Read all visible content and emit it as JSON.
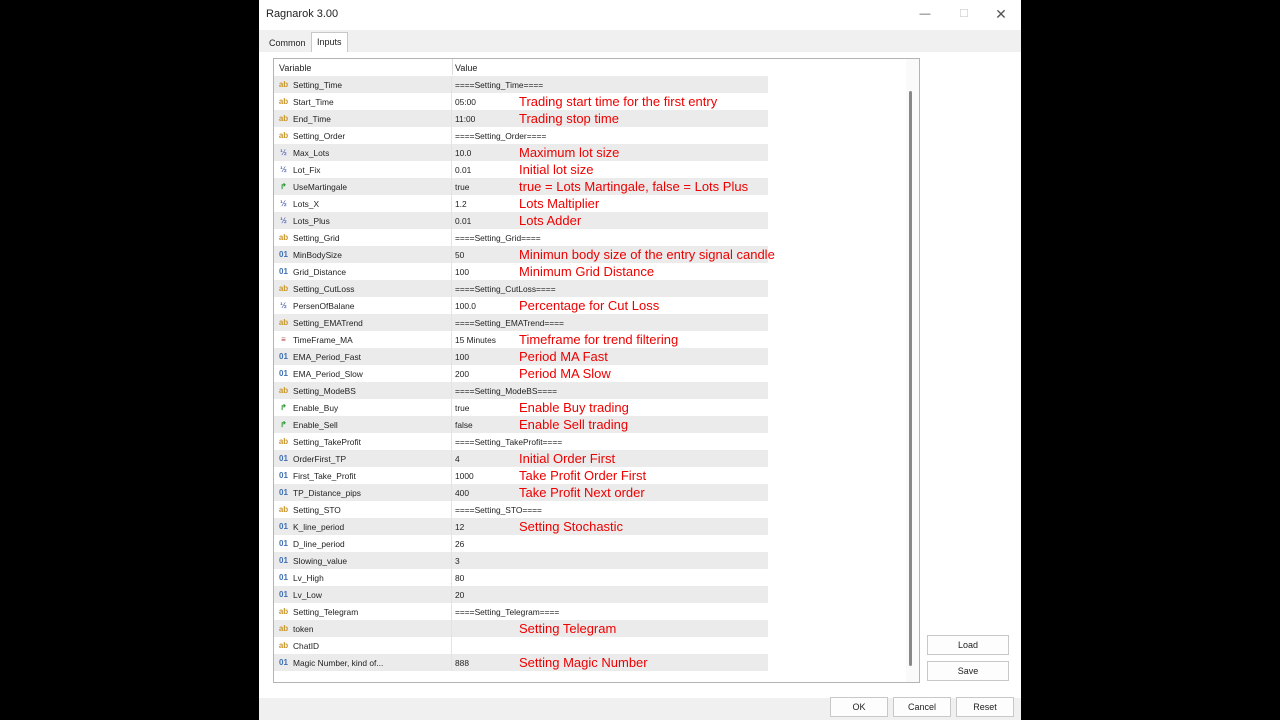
{
  "window": {
    "title": "Ragnarok  3.00",
    "minimize": "—",
    "maximize": "☐",
    "close": "✕"
  },
  "tabs": [
    {
      "label": "Common"
    },
    {
      "label": "Inputs"
    }
  ],
  "table": {
    "headers": {
      "variable": "Variable",
      "value": "Value"
    },
    "rows": [
      {
        "type": "ab",
        "icon": "ab",
        "name": "Setting_Time",
        "value": "====Setting_Time====",
        "note": ""
      },
      {
        "type": "ab",
        "icon": "ab",
        "name": "Start_Time",
        "value": "05:00",
        "note": "Trading start time for the  first entry"
      },
      {
        "type": "ab",
        "icon": "ab",
        "name": "End_Time",
        "value": "11:00",
        "note": "Trading stop time"
      },
      {
        "type": "ab",
        "icon": "ab",
        "name": "Setting_Order",
        "value": "====Setting_Order====",
        "note": ""
      },
      {
        "type": "half",
        "icon": "½",
        "name": "Max_Lots",
        "value": "10.0",
        "note": "Maximum  lot size"
      },
      {
        "type": "half",
        "icon": "½",
        "name": "Lot_Fix",
        "value": "0.01",
        "note": "Initial lot size"
      },
      {
        "type": "bool",
        "icon": "↱",
        "name": "UseMartingale",
        "value": "true",
        "note": "true = Lots Martingale, false = Lots Plus"
      },
      {
        "type": "half",
        "icon": "½",
        "name": "Lots_X",
        "value": "1.2",
        "note": "Lots Maltiplier"
      },
      {
        "type": "half",
        "icon": "½",
        "name": "Lots_Plus",
        "value": "0.01",
        "note": "Lots Adder"
      },
      {
        "type": "ab",
        "icon": "ab",
        "name": "Setting_Grid",
        "value": "====Setting_Grid====",
        "note": ""
      },
      {
        "type": "01",
        "icon": "01",
        "name": "MinBodySize",
        "value": "50",
        "note": "Minimun  body size of the entry signal candle"
      },
      {
        "type": "01",
        "icon": "01",
        "name": "Grid_Distance",
        "value": "100",
        "note": "Minimum  Grid Distance"
      },
      {
        "type": "ab",
        "icon": "ab",
        "name": "Setting_CutLoss",
        "value": "====Setting_CutLoss====",
        "note": ""
      },
      {
        "type": "half",
        "icon": "½",
        "name": "PersenOfBalane",
        "value": "100.0",
        "note": "Percentage for Cut Loss"
      },
      {
        "type": "ab",
        "icon": "ab",
        "name": "Setting_EMATrend",
        "value": "====Setting_EMATrend====",
        "note": ""
      },
      {
        "type": "enum",
        "icon": "≡",
        "name": "TimeFrame_MA",
        "value": "15 Minutes",
        "note": "Timeframe for trend filtering"
      },
      {
        "type": "01",
        "icon": "01",
        "name": "EMA_Period_Fast",
        "value": "100",
        "note": "Period MA Fast"
      },
      {
        "type": "01",
        "icon": "01",
        "name": "EMA_Period_Slow",
        "value": "200",
        "note": "Period MA Slow"
      },
      {
        "type": "ab",
        "icon": "ab",
        "name": "Setting_ModeBS",
        "value": "====Setting_ModeBS====",
        "note": ""
      },
      {
        "type": "bool",
        "icon": "↱",
        "name": "Enable_Buy",
        "value": "true",
        "note": "Enable Buy trading"
      },
      {
        "type": "bool",
        "icon": "↱",
        "name": "Enable_Sell",
        "value": "false",
        "note": "Enable Sell trading"
      },
      {
        "type": "ab",
        "icon": "ab",
        "name": "Setting_TakeProfit",
        "value": "====Setting_TakeProfit====",
        "note": ""
      },
      {
        "type": "01",
        "icon": "01",
        "name": "OrderFirst_TP",
        "value": "4",
        "note": "Initial Order First"
      },
      {
        "type": "01",
        "icon": "01",
        "name": "First_Take_Profit",
        "value": "1000",
        "note": "Take Profit Order First"
      },
      {
        "type": "01",
        "icon": "01",
        "name": "TP_Distance_pips",
        "value": "400",
        "note": "Take Profit Next order"
      },
      {
        "type": "ab",
        "icon": "ab",
        "name": "Setting_STO",
        "value": "====Setting_STO====",
        "note": ""
      },
      {
        "type": "01",
        "icon": "01",
        "name": "K_line_period",
        "value": "12",
        "note": "Setting Stochastic"
      },
      {
        "type": "01",
        "icon": "01",
        "name": "D_line_period",
        "value": "26",
        "note": ""
      },
      {
        "type": "01",
        "icon": "01",
        "name": "Slowing_value",
        "value": "3",
        "note": ""
      },
      {
        "type": "01",
        "icon": "01",
        "name": "Lv_High",
        "value": "80",
        "note": ""
      },
      {
        "type": "01",
        "icon": "01",
        "name": "Lv_Low",
        "value": "20",
        "note": ""
      },
      {
        "type": "ab",
        "icon": "ab",
        "name": "Setting_Telegram",
        "value": "====Setting_Telegram====",
        "note": ""
      },
      {
        "type": "ab",
        "icon": "ab",
        "name": "token",
        "value": "",
        "note": "Setting Telegram"
      },
      {
        "type": "ab",
        "icon": "ab",
        "name": "ChatID",
        "value": "",
        "note": ""
      },
      {
        "type": "01",
        "icon": "01",
        "name": "Magic Number, kind of...",
        "value": "888",
        "note": "Setting Magic Number"
      }
    ]
  },
  "side_buttons": {
    "load": "Load",
    "save": "Save"
  },
  "bottom_buttons": {
    "ok": "OK",
    "cancel": "Cancel",
    "reset": "Reset"
  },
  "colors": {
    "note": "#ee0000",
    "alt_row": "#ebebeb",
    "top_mark_green": "#2e8b3a"
  }
}
